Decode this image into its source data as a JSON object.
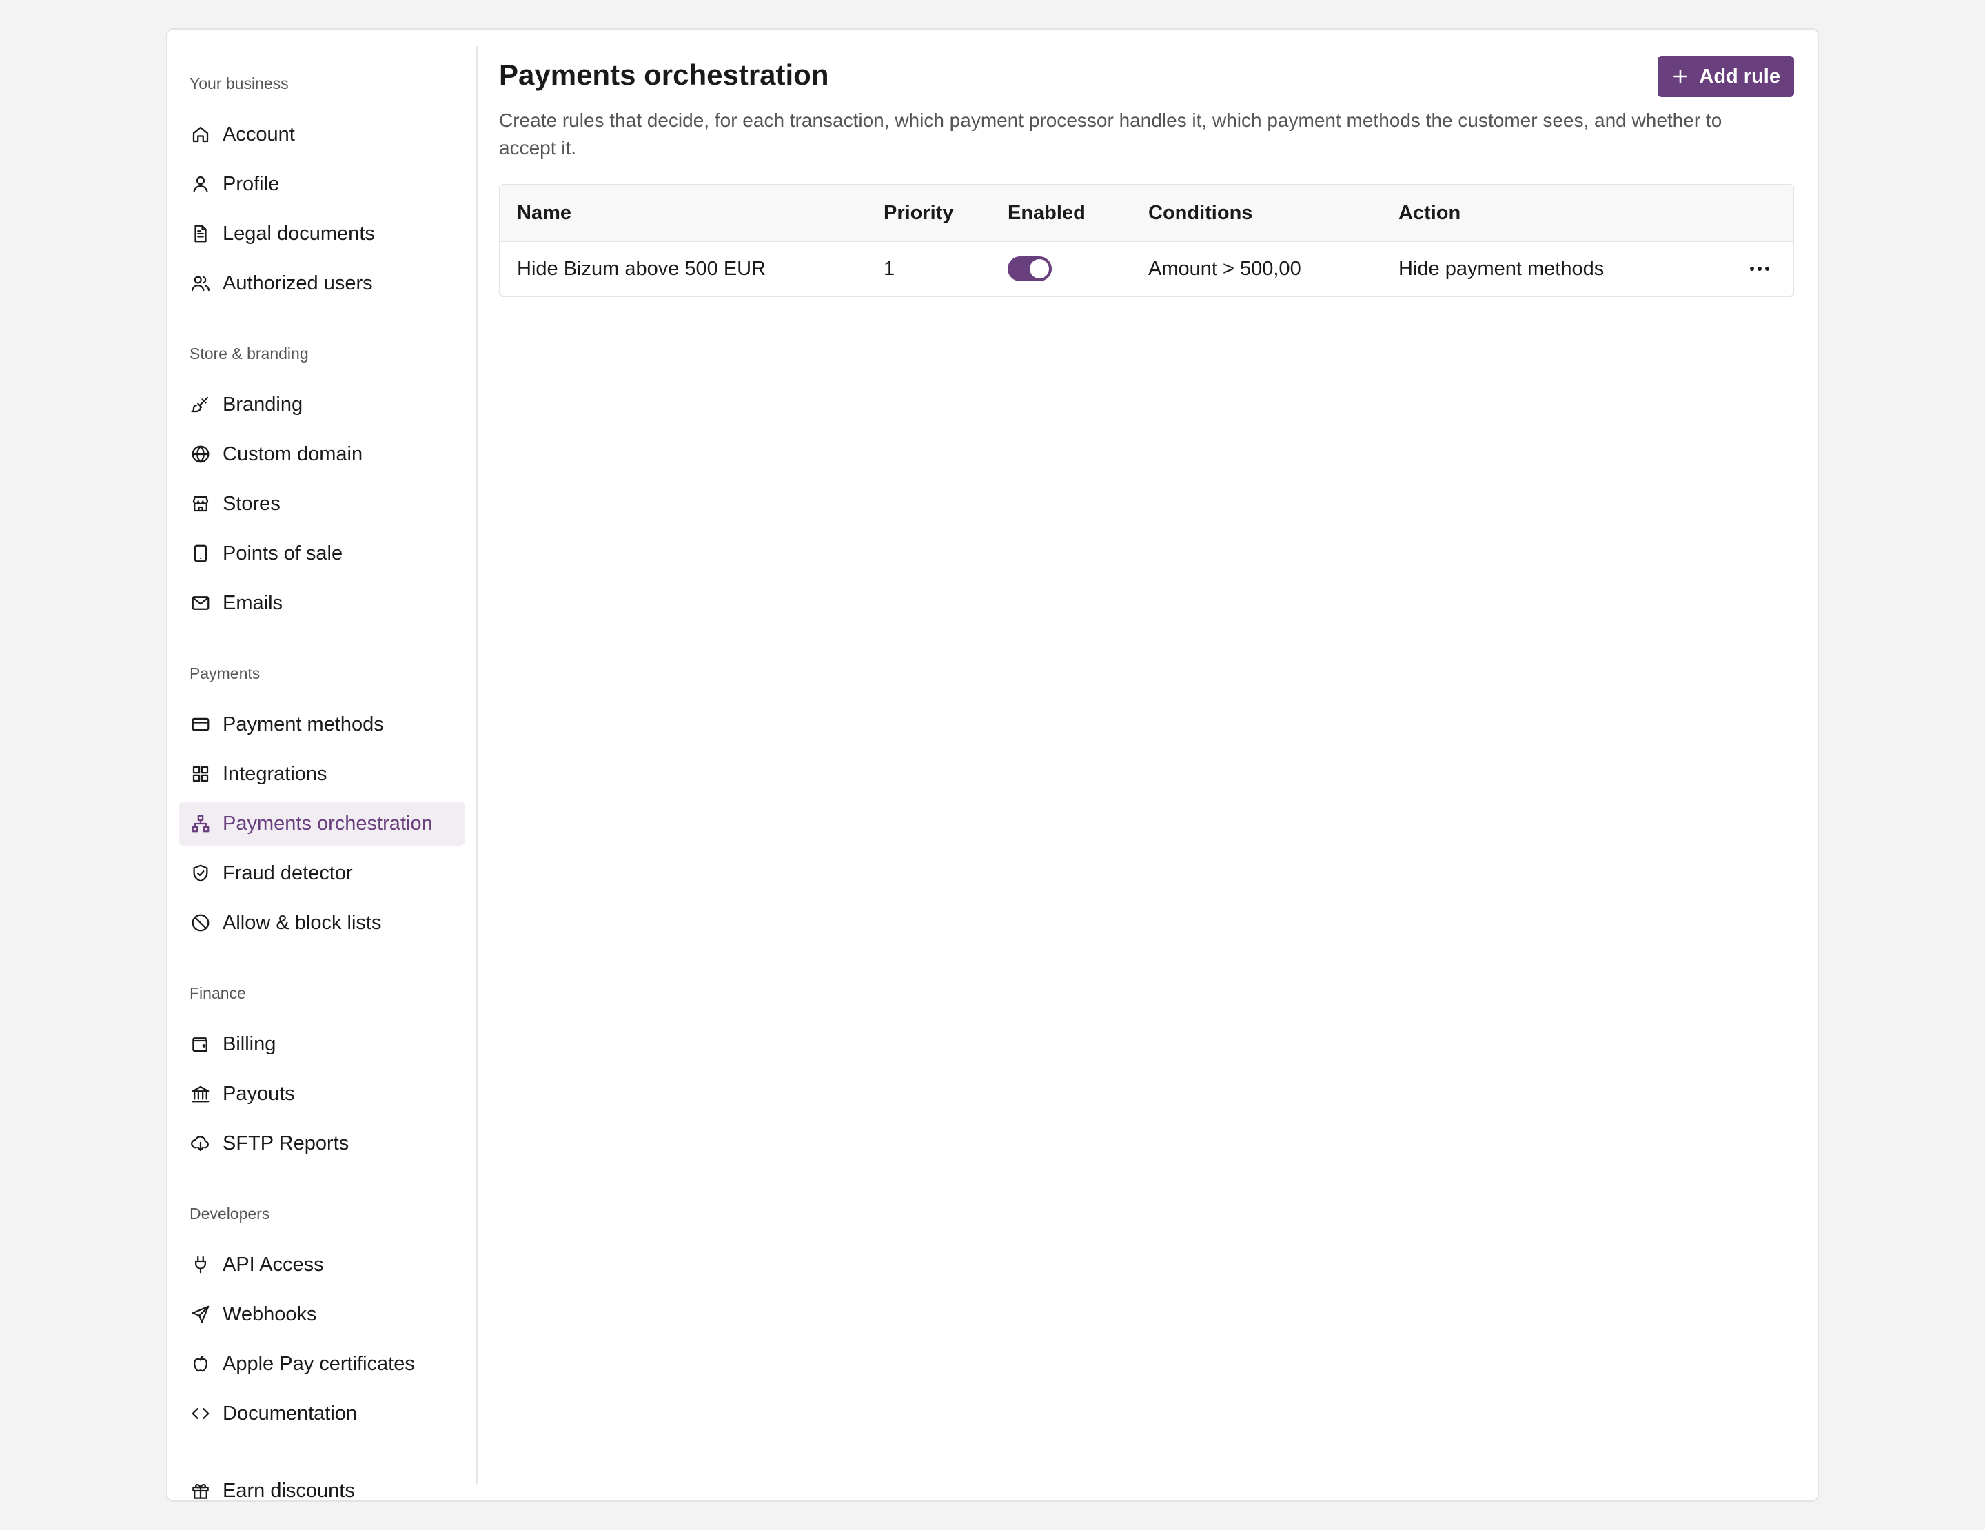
{
  "theme": {
    "accent": "#6a3f7e",
    "active_bg": "#f1edf3"
  },
  "sidebar": {
    "sections": [
      {
        "title": "Your business",
        "items": [
          {
            "label": "Account",
            "icon": "home-icon"
          },
          {
            "label": "Profile",
            "icon": "user-icon"
          },
          {
            "label": "Legal documents",
            "icon": "document-icon"
          },
          {
            "label": "Authorized users",
            "icon": "users-icon"
          }
        ]
      },
      {
        "title": "Store & branding",
        "items": [
          {
            "label": "Branding",
            "icon": "brush-icon"
          },
          {
            "label": "Custom domain",
            "icon": "globe-icon"
          },
          {
            "label": "Stores",
            "icon": "store-icon"
          },
          {
            "label": "Points of sale",
            "icon": "tablet-icon"
          },
          {
            "label": "Emails",
            "icon": "mail-icon"
          }
        ]
      },
      {
        "title": "Payments",
        "items": [
          {
            "label": "Payment methods",
            "icon": "credit-card-icon"
          },
          {
            "label": "Integrations",
            "icon": "grid-icon"
          },
          {
            "label": "Payments orchestration",
            "icon": "network-icon",
            "active": true
          },
          {
            "label": "Fraud detector",
            "icon": "shield-check-icon"
          },
          {
            "label": "Allow & block lists",
            "icon": "ban-icon"
          }
        ]
      },
      {
        "title": "Finance",
        "items": [
          {
            "label": "Billing",
            "icon": "wallet-icon"
          },
          {
            "label": "Payouts",
            "icon": "bank-icon"
          },
          {
            "label": "SFTP Reports",
            "icon": "cloud-download-icon"
          }
        ]
      },
      {
        "title": "Developers",
        "items": [
          {
            "label": "API Access",
            "icon": "plug-icon"
          },
          {
            "label": "Webhooks",
            "icon": "send-icon"
          },
          {
            "label": "Apple Pay certificates",
            "icon": "apple-icon"
          },
          {
            "label": "Documentation",
            "icon": "code-icon"
          }
        ]
      }
    ],
    "footer_item": {
      "label": "Earn discounts",
      "icon": "gift-icon"
    }
  },
  "main": {
    "title": "Payments orchestration",
    "add_button_label": "Add rule",
    "description": "Create rules that decide, for each transaction, which payment processor handles it, which payment methods the customer sees, and whether to accept it.",
    "table": {
      "headers": [
        "Name",
        "Priority",
        "Enabled",
        "Conditions",
        "Action"
      ],
      "rows": [
        {
          "name": "Hide Bizum above 500 EUR",
          "priority": "1",
          "enabled": true,
          "conditions": "Amount > 500,00",
          "action": "Hide payment methods"
        }
      ]
    }
  }
}
